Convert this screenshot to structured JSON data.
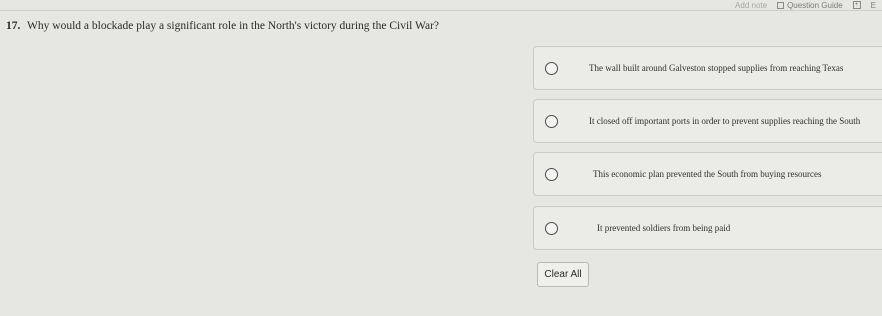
{
  "toolbar": {
    "add_note": "Add note",
    "question_guide": "Question Guide",
    "expand": "E"
  },
  "question": {
    "number": "17.",
    "text": "Why would a blockade play a significant role in the North's victory during the Civil War?"
  },
  "choices": [
    {
      "label": "The wall built around Galveston stopped supplies from reaching Texas",
      "selected": false
    },
    {
      "label": "It closed off important ports in order to prevent supplies reaching the South",
      "selected": false
    },
    {
      "label": "This economic plan prevented the South from buying resources",
      "selected": false
    },
    {
      "label": "It prevented soldiers from being paid",
      "selected": false
    }
  ],
  "actions": {
    "clear_all": "Clear All"
  }
}
